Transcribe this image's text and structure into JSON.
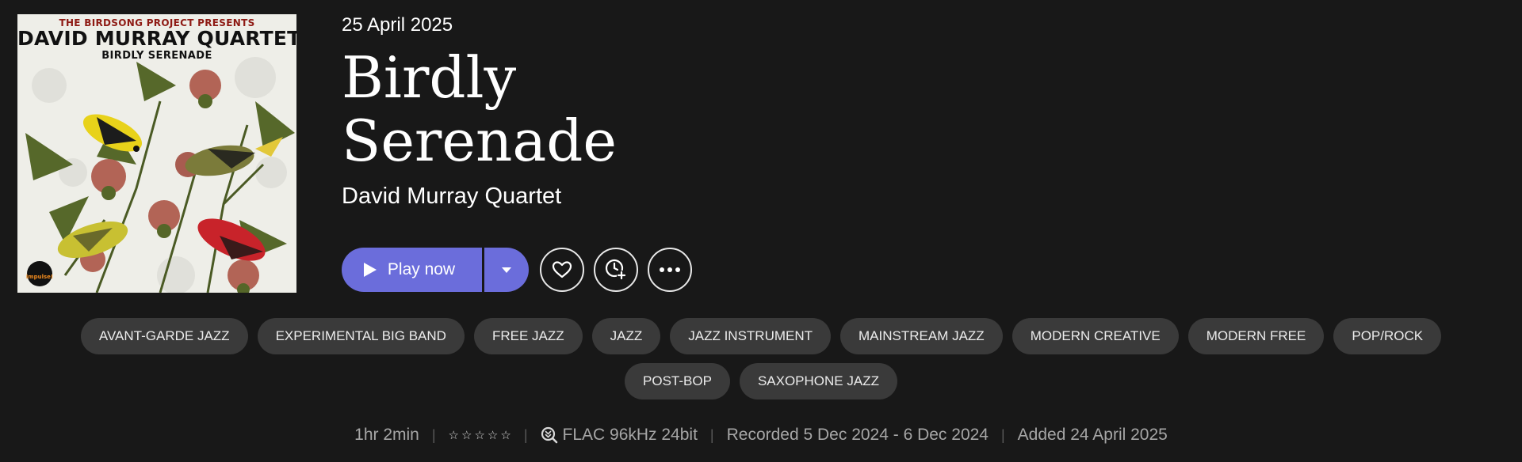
{
  "cover": {
    "pretitle": "THE BIRDSONG PROJECT PRESENTS",
    "title": "DAVID MURRAY QUARTET",
    "subtitle": "BIRDLY SERENADE",
    "label": "impulse!"
  },
  "release_date": "25 April 2025",
  "album_title": "Birdly Serenade",
  "artist": "David Murray Quartet",
  "actions": {
    "play_label": "Play now",
    "dropdown_icon": "caret-down-icon",
    "favorite_icon": "heart-icon",
    "queue_icon": "clock-plus-icon",
    "more_icon": "more-icon"
  },
  "genres": [
    "AVANT-GARDE JAZZ",
    "EXPERIMENTAL BIG BAND",
    "FREE JAZZ",
    "JAZZ",
    "JAZZ INSTRUMENT",
    "MAINSTREAM JAZZ",
    "MODERN CREATIVE",
    "MODERN FREE",
    "POP/ROCK",
    "POST-BOP",
    "SAXOPHONE JAZZ"
  ],
  "info": {
    "duration": "1hr 2min",
    "rating": 0,
    "rating_max": 5,
    "quality": "FLAC 96kHz 24bit",
    "recorded": "Recorded 5 Dec 2024 - 6 Dec 2024",
    "added": "Added 24 April 2025"
  },
  "colors": {
    "background": "#181818",
    "accent": "#6b6ddb",
    "chip": "#3a3a3a",
    "muted_text": "#a6a6a6"
  }
}
